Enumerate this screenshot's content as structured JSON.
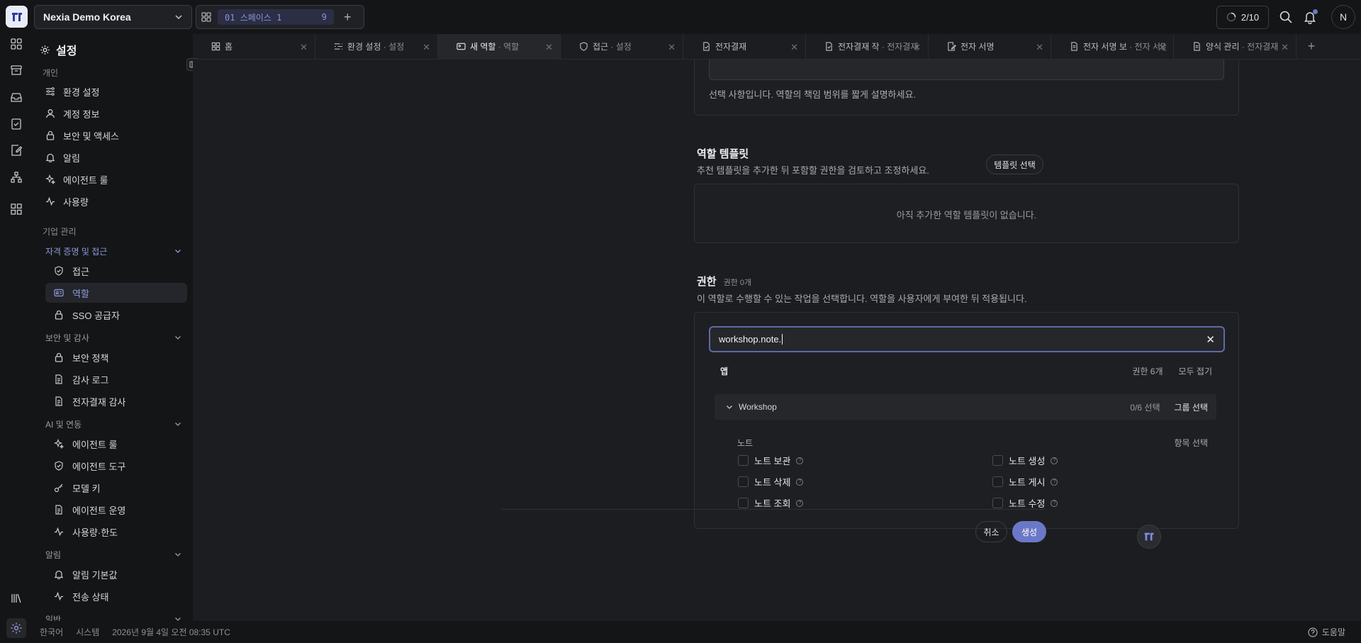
{
  "workspace": {
    "name": "Nexia Demo Korea"
  },
  "space": {
    "id": "01",
    "name": "스페이스 1",
    "count": "9"
  },
  "header": {
    "progress": "2/10",
    "avatar_initial": "N"
  },
  "sidebar": {
    "title": "설정",
    "personal_label": "개인",
    "personal_items": [
      "환경 설정",
      "계정 정보",
      "보안 및 액세스",
      "알림",
      "에이전트 룰",
      "사용량"
    ],
    "enterprise_label": "기업 관리",
    "groups": [
      {
        "label": "자격 증명 및 접근",
        "items": [
          "접근",
          "역할",
          "SSO 공급자"
        ]
      },
      {
        "label": "보안 및 감사",
        "items": [
          "보안 정책",
          "감사 로그",
          "전자결재 감사"
        ]
      },
      {
        "label": "AI 및 연동",
        "items": [
          "에이전트 룰",
          "에이전트 도구",
          "모델 키",
          "에이전트 운영",
          "사용량·한도"
        ]
      },
      {
        "label": "알림",
        "items": [
          "알림 기본값",
          "전송 상태"
        ]
      },
      {
        "label": "일반"
      }
    ]
  },
  "tabs": [
    {
      "label": "홈",
      "sub": ""
    },
    {
      "label": "환경 설정",
      "sub": " · 설정"
    },
    {
      "label": "새 역할",
      "sub": " · 역할"
    },
    {
      "label": "접근",
      "sub": " · 설정"
    },
    {
      "label": "전자결재",
      "sub": ""
    },
    {
      "label": "전자결재 작",
      "sub": " · 전자결재"
    },
    {
      "label": "전자 서명",
      "sub": ""
    },
    {
      "label": "전자 서명 보",
      "sub": " · 전자 서명"
    },
    {
      "label": "양식 관리",
      "sub": " · 전자결재"
    }
  ],
  "description_hint": "선택 사항입니다. 역할의 책임 범위를 짧게 설명하세요.",
  "templates": {
    "title": "역할 템플릿",
    "desc": "추천 템플릿을 추가한 뒤 포함할 권한을 검토하고 조정하세요.",
    "button": "템플릿 선택",
    "empty": "아직 추가한 역할 템플릿이 없습니다."
  },
  "permissions": {
    "title": "권한",
    "count": "권한 0개",
    "desc": "이 역할로 수행할 수 있는 작업을 선택합니다. 역할을 사용자에게 부여한 뒤 적용됩니다.",
    "search_value": "workshop.note.",
    "app_label": "앱",
    "perm_count": "권한 6개",
    "collapse_all": "모두 접기",
    "group_name": "Workshop",
    "group_selected": "0/6 선택",
    "group_select": "그룹 선택",
    "section": "노트",
    "section_select": "항목 선택",
    "items_left": [
      "노트 보관",
      "노트 삭제",
      "노트 조회"
    ],
    "items_right": [
      "노트 생성",
      "노트 게시",
      "노트 수정"
    ]
  },
  "actions": {
    "cancel": "취소",
    "create": "생성"
  },
  "footer": {
    "lang": "한국어",
    "theme": "시스템",
    "datetime": "2026년 9월 4일 오전 08:35 UTC",
    "help": "도움말"
  },
  "colors": {
    "accent": "#6b78c8",
    "accent_text": "#8f9ad8",
    "background": "#1c1d20"
  }
}
